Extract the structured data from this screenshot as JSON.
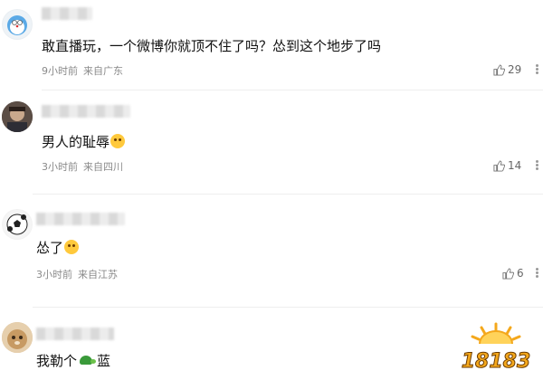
{
  "comments": [
    {
      "text": "敢直播玩，一个微博你就顶不住了吗？怂到这个地步了吗",
      "time": "9小时前",
      "location": "来自广东",
      "likes": "29",
      "emoji": ""
    },
    {
      "text": "男人的耻辱",
      "time": "3小时前",
      "location": "来自四川",
      "likes": "14",
      "emoji": "face-emoji"
    },
    {
      "text": "怂了",
      "time": "3小时前",
      "location": "来自江苏",
      "likes": "6",
      "emoji": "face-emoji"
    },
    {
      "text_before": "我勒个",
      "text_after": "蓝",
      "emoji": "turtle-emoji"
    }
  ],
  "watermark": {
    "text": "18183"
  },
  "colors": {
    "meta": "#8a8a8a",
    "like": "#666666",
    "watermark": "#f4a81c"
  }
}
